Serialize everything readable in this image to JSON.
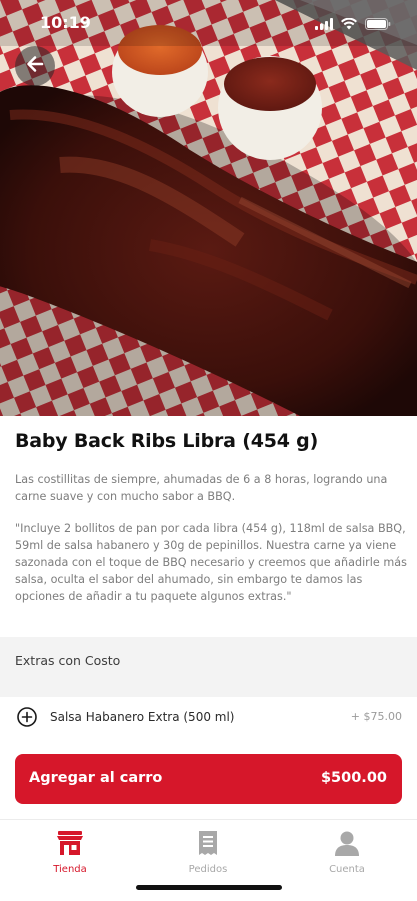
{
  "status_bar": {
    "time": "10:19",
    "icons": [
      "signal-icon",
      "wifi-icon",
      "battery-icon"
    ]
  },
  "product": {
    "title": "Baby Back Ribs Libra (454 g)",
    "description_1": "Las costillitas de siempre, ahumadas de 6 a 8 horas, logrando una carne suave y con mucho sabor a BBQ.",
    "description_2": "\"Incluye 2 bollitos de pan por cada libra (454 g), 118ml de salsa BBQ, 59ml de salsa habanero y 30g de pepinillos. Nuestra carne ya viene sazonada con el toque de BBQ necesario y creemos que añadirle más salsa, oculta el sabor del ahumado, sin embargo te damos las opciones de añadir a tu paquete algunos extras.\""
  },
  "extras": {
    "section_title": "Extras con Costo",
    "items": [
      {
        "name": "Salsa Habanero Extra (500 ml)",
        "price": "+ $75.00"
      }
    ]
  },
  "cart_button": {
    "label": "Agregar al carro",
    "price": "$500.00"
  },
  "tabs": [
    {
      "label": "Tienda",
      "icon": "store-icon",
      "active": true
    },
    {
      "label": "Pedidos",
      "icon": "receipt-icon",
      "active": false
    },
    {
      "label": "Cuenta",
      "icon": "user-icon",
      "active": false
    }
  ],
  "colors": {
    "accent": "#d6172a",
    "tab_inactive": "#a8a8a8"
  }
}
